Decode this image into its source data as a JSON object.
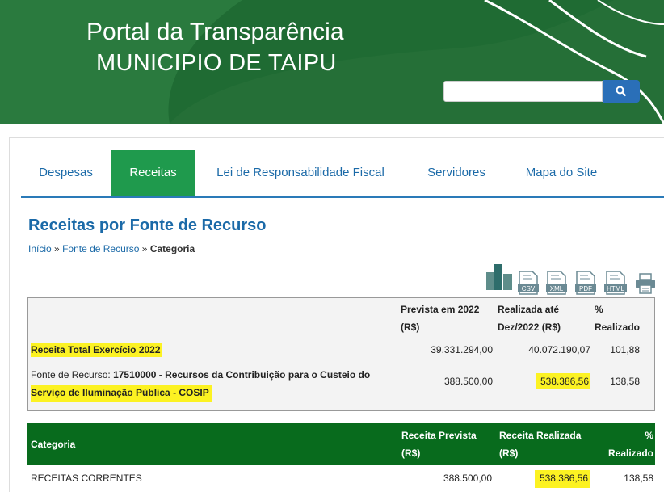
{
  "header": {
    "portal_title": "Portal da Transparência",
    "municipality": "MUNICIPIO DE TAIPU",
    "search_value": "",
    "colors": {
      "header_bg": "#1f6b33",
      "accent_green": "#1f9a4d",
      "link_blue": "#1b6aa8",
      "highlight": "#fcf222"
    }
  },
  "nav": {
    "items": [
      {
        "label": "Despesas",
        "active": false
      },
      {
        "label": "Receitas",
        "active": true
      },
      {
        "label": "Lei de Responsabilidade Fiscal",
        "active": false
      },
      {
        "label": "Servidores",
        "active": false
      },
      {
        "label": "Mapa do Site",
        "active": false
      }
    ]
  },
  "page": {
    "title": "Receitas por Fonte de Recurso",
    "breadcrumb": {
      "home": "Início",
      "sep": "»",
      "level1": "Fonte de Recurso",
      "current": "Categoria"
    }
  },
  "export": {
    "csv": "CSV",
    "xml": "XML",
    "pdf": "PDF",
    "html": "HTML"
  },
  "summary": {
    "headers": {
      "prevista_1": "Prevista em 2022",
      "prevista_2": "(R$)",
      "realizada_1": "Realizada até",
      "realizada_2": "Dez/2022 (R$)",
      "pct_1": "%",
      "pct_2": "Realizado"
    },
    "total_row": {
      "label": "Receita Total Exercício 2022",
      "prevista": "39.331.294,00",
      "realizada": "40.072.190,07",
      "pct": "101,88"
    },
    "fonte_row": {
      "prefix": "Fonte de Recurso:",
      "code_desc_1": "17510000 - Recursos da Contribuição para o Custeio do",
      "code_desc_2": "Serviço de Iluminação Pública - COSIP",
      "prevista": "388.500,00",
      "realizada": "538.386,56",
      "pct": "138,58"
    }
  },
  "categoria_table": {
    "headers": {
      "categoria": "Categoria",
      "prevista_1": "Receita Prevista",
      "prevista_2": "(R$)",
      "realizada_1": "Receita Realizada",
      "realizada_2": "(R$)",
      "pct_1": "%",
      "pct_2": "Realizado"
    },
    "rows": [
      {
        "categoria": "RECEITAS CORRENTES",
        "prevista": "388.500,00",
        "realizada": "538.386,56",
        "pct": "138,58"
      }
    ]
  }
}
